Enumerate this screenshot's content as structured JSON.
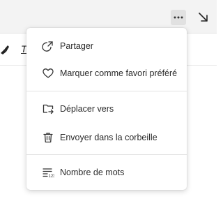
{
  "toolbar": {
    "more_icon": "more-horizontal-icon",
    "expand_icon": "arrow-down-right-icon"
  },
  "formatbar": {
    "italic_label": "T"
  },
  "menu": {
    "items": [
      {
        "label": "Partager",
        "icon": "share-icon"
      },
      {
        "label": "Marquer comme favori préféré",
        "icon": "heart-icon"
      },
      {
        "label": "Déplacer vers",
        "icon": "folder-move-icon"
      },
      {
        "label": "Envoyer dans la corbeille",
        "icon": "trash-icon"
      },
      {
        "label": "Nombre de mots",
        "icon": "word-count-icon"
      }
    ]
  }
}
